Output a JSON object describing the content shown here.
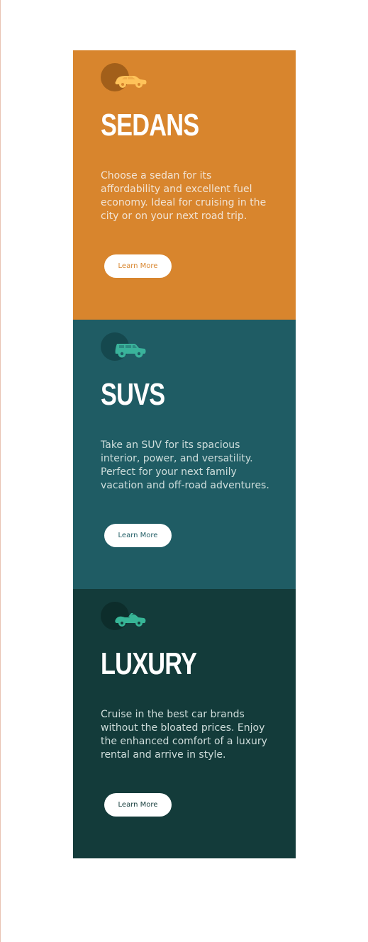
{
  "cards": [
    {
      "title": "SEDANS",
      "description": "Choose a sedan for its affordability and excellent fuel economy. Ideal for cruising in the city or on your next road trip.",
      "button_label": "Learn More",
      "icon": "sedan-car-icon",
      "color": "#d8852d"
    },
    {
      "title": "SUVS",
      "description": "Take an SUV for its spacious interior, power, and versatility. Perfect for your next family vacation and off-road adventures.",
      "button_label": "Learn More",
      "icon": "suv-car-icon",
      "color": "#1f5c64"
    },
    {
      "title": "LUXURY",
      "description": "Cruise in the best car brands without the bloated prices. Enjoy the enhanced comfort of a luxury rental and arrive in style.",
      "button_label": "Learn More",
      "icon": "luxury-car-icon",
      "color": "#133b3a"
    }
  ]
}
